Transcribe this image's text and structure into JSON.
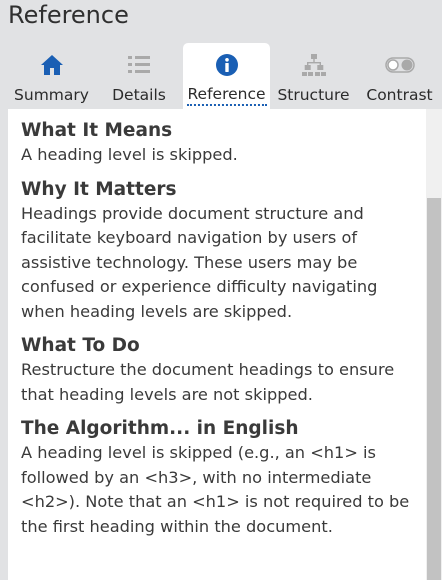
{
  "header": {
    "title": "Reference"
  },
  "tabs": [
    {
      "label": "Summary",
      "icon": "home-icon",
      "icon_color": "#1a5fb4",
      "active": false
    },
    {
      "label": "Details",
      "icon": "list-icon",
      "icon_color": "#a9a9a9",
      "active": false
    },
    {
      "label": "Reference",
      "icon": "info-icon",
      "icon_color": "#1a5fb4",
      "active": true
    },
    {
      "label": "Structure",
      "icon": "sitemap-icon",
      "icon_color": "#a9a9a9",
      "active": false
    },
    {
      "label": "Contrast",
      "icon": "toggle-icon",
      "icon_color": "#a9a9a9",
      "active": false
    }
  ],
  "sections": [
    {
      "heading": "What It Means",
      "body": "A heading level is skipped."
    },
    {
      "heading": "Why It Matters",
      "body": "Headings provide document structure and facilitate keyboard navigation by users of assistive technology. These users may be confused or experience difficulty navigating when heading levels are skipped."
    },
    {
      "heading": "What To Do",
      "body": "Restructure the document headings to ensure that heading levels are not skipped."
    },
    {
      "heading": "The Algorithm... in English",
      "body": "A heading level is skipped (e.g., an <h1> is followed by an <h3>, with no intermediate <h2>). Note that an <h1> is not required to be the first heading within the document."
    }
  ]
}
